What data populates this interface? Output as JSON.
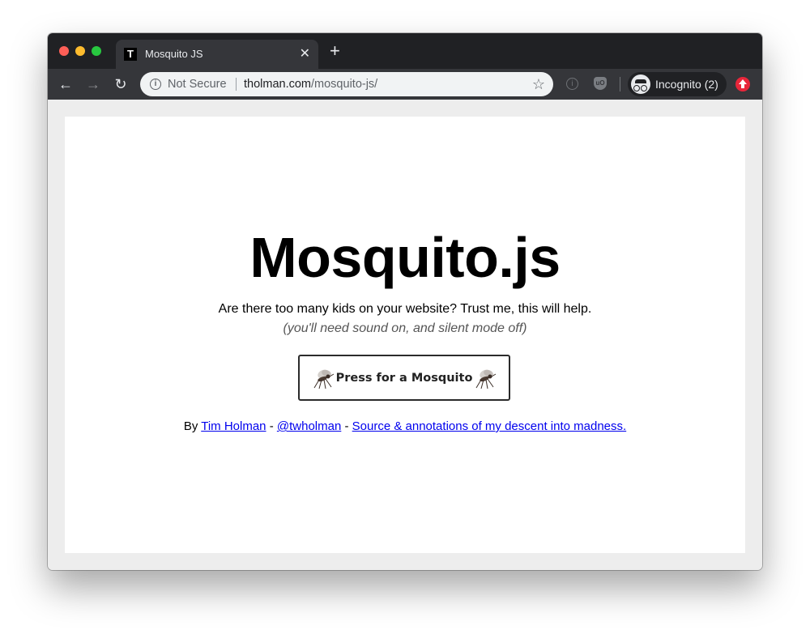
{
  "browser": {
    "tab": {
      "favicon_letter": "T",
      "title": "Mosquito JS",
      "close_glyph": "✕"
    },
    "new_tab_glyph": "+",
    "nav": {
      "back": "←",
      "forward": "→",
      "reload": "↻"
    },
    "omnibox": {
      "security_text": "Not Secure",
      "url_host": "tholman.com",
      "url_path": "/mosquito-js/",
      "star_glyph": "☆"
    },
    "extensions": {
      "info_glyph": "i",
      "ublock_label": "uO"
    },
    "incognito_label": "Incognito (2)"
  },
  "page": {
    "title": "Mosquito.js",
    "tagline": "Are there too many kids on your website? Trust me, this will help.",
    "subtagline": "(you'll need sound on, and silent mode off)",
    "button_label": "Press for a Mosquito",
    "byline": {
      "prefix": "By",
      "author_link": "Tim Holman",
      "sep1": "-",
      "handle_link": "@twholman",
      "sep2": "-",
      "source_link": "Source & annotations of my descent into madness."
    }
  },
  "colors": {
    "tabstrip": "#202124",
    "toolbar": "#35363a",
    "link": "#0000ee",
    "update_badge": "#e8263a"
  }
}
